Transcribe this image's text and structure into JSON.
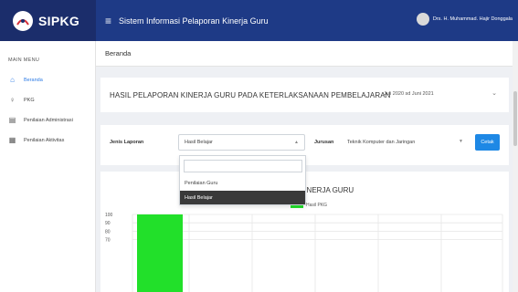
{
  "app": {
    "brand": "SIPKG",
    "title": "Sistem Informasi Pelaporan Kinerja Guru",
    "user": "Drs. H. Muhammad. Hajir Donggala"
  },
  "sidebar": {
    "heading": "MAIN MENU",
    "items": [
      {
        "label": "Beranda",
        "icon": "home-icon",
        "active": true
      },
      {
        "label": "PKG",
        "icon": "user-icon",
        "active": false
      },
      {
        "label": "Penilaian Administrasi",
        "icon": "document-icon",
        "active": false
      },
      {
        "label": "Penilaian Aktivitas",
        "icon": "grid-icon",
        "active": false
      }
    ]
  },
  "breadcrumb": "Beranda",
  "report": {
    "title": "HASIL PELAPORAN KINERJA GURU PADA KETERLAKSANAAN PEMBELAJARAN",
    "period": "Juli 2020 sd Juni 2021"
  },
  "filter": {
    "jenis_label": "Jenis Laporan",
    "jenis_value": "Hasil Belajar",
    "jurusan_label": "Jurusan",
    "jurusan_value": "Teknik Komputer dan Jaringan",
    "cetak_label": "Cetak"
  },
  "dropdown": {
    "options": [
      {
        "label": "Penilaian Guru",
        "selected": false
      },
      {
        "label": "Hasil Belajar",
        "selected": true
      }
    ]
  },
  "chart_data": {
    "type": "bar",
    "title": "KINERJA GURU",
    "categories": [
      ""
    ],
    "series": [
      {
        "name": "Hasil PKG",
        "values": [
          100
        ],
        "color": "#22e02a"
      }
    ],
    "yticks": [
      100,
      90,
      80,
      70
    ],
    "ylim": [
      60,
      100
    ],
    "grid": true,
    "legend": "top"
  }
}
